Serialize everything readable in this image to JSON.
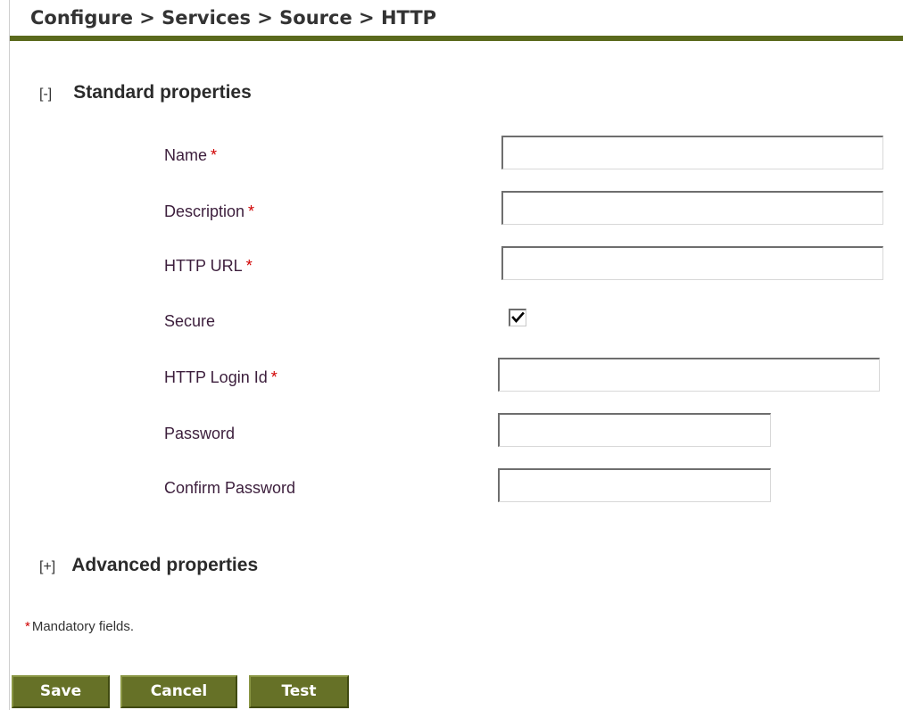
{
  "breadcrumb": "Configure > Services > Source > HTTP",
  "standard": {
    "toggle": "[-]",
    "title": "Standard properties"
  },
  "fields": {
    "name": {
      "label": "Name",
      "required_mark": "*",
      "value": ""
    },
    "description": {
      "label": "Description",
      "required_mark": "*",
      "value": ""
    },
    "http_url": {
      "label": "HTTP URL",
      "required_mark": "*",
      "value": ""
    },
    "secure": {
      "label": "Secure",
      "checked": true
    },
    "login_id": {
      "label": "HTTP Login Id",
      "required_mark": "*",
      "value": ""
    },
    "password": {
      "label": "Password",
      "value": ""
    },
    "confirm_password": {
      "label": "Confirm Password",
      "value": ""
    }
  },
  "advanced": {
    "toggle": "[+]",
    "title": "Advanced properties"
  },
  "mandatory_note": {
    "mark": "*",
    "text": "Mandatory fields."
  },
  "buttons": {
    "save": "Save",
    "cancel": "Cancel",
    "test": "Test"
  },
  "colors": {
    "accent": "#5b6a1d",
    "button_bg": "#667127",
    "required": "#d00000",
    "label_text": "#3c1e3c"
  }
}
